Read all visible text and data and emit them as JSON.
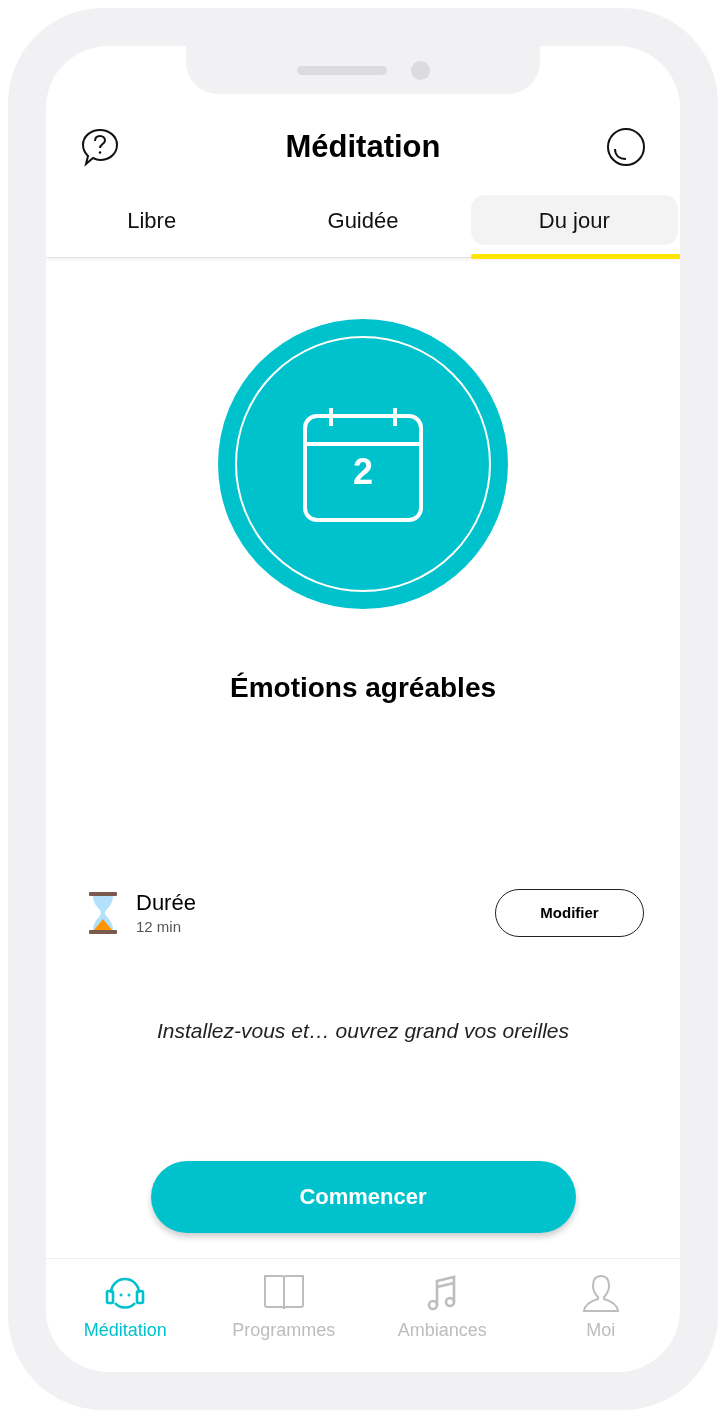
{
  "header": {
    "title": "Méditation"
  },
  "tabs": [
    {
      "label": "Libre",
      "selected": false
    },
    {
      "label": "Guidée",
      "selected": false
    },
    {
      "label": "Du jour",
      "selected": true
    }
  ],
  "session": {
    "day": "2",
    "title": "Émotions agréables",
    "duration_label": "Durée",
    "duration_value": "12 min",
    "modify_button": "Modifier",
    "tagline": "Installez-vous et… ouvrez grand vos oreilles",
    "start_button": "Commencer"
  },
  "bottom_nav": [
    {
      "kind": "headphones",
      "label": "Méditation",
      "selected": true
    },
    {
      "kind": "book",
      "label": "Programmes",
      "selected": false
    },
    {
      "kind": "music",
      "label": "Ambiances",
      "selected": false
    },
    {
      "kind": "user",
      "label": "Moi",
      "selected": false
    }
  ]
}
